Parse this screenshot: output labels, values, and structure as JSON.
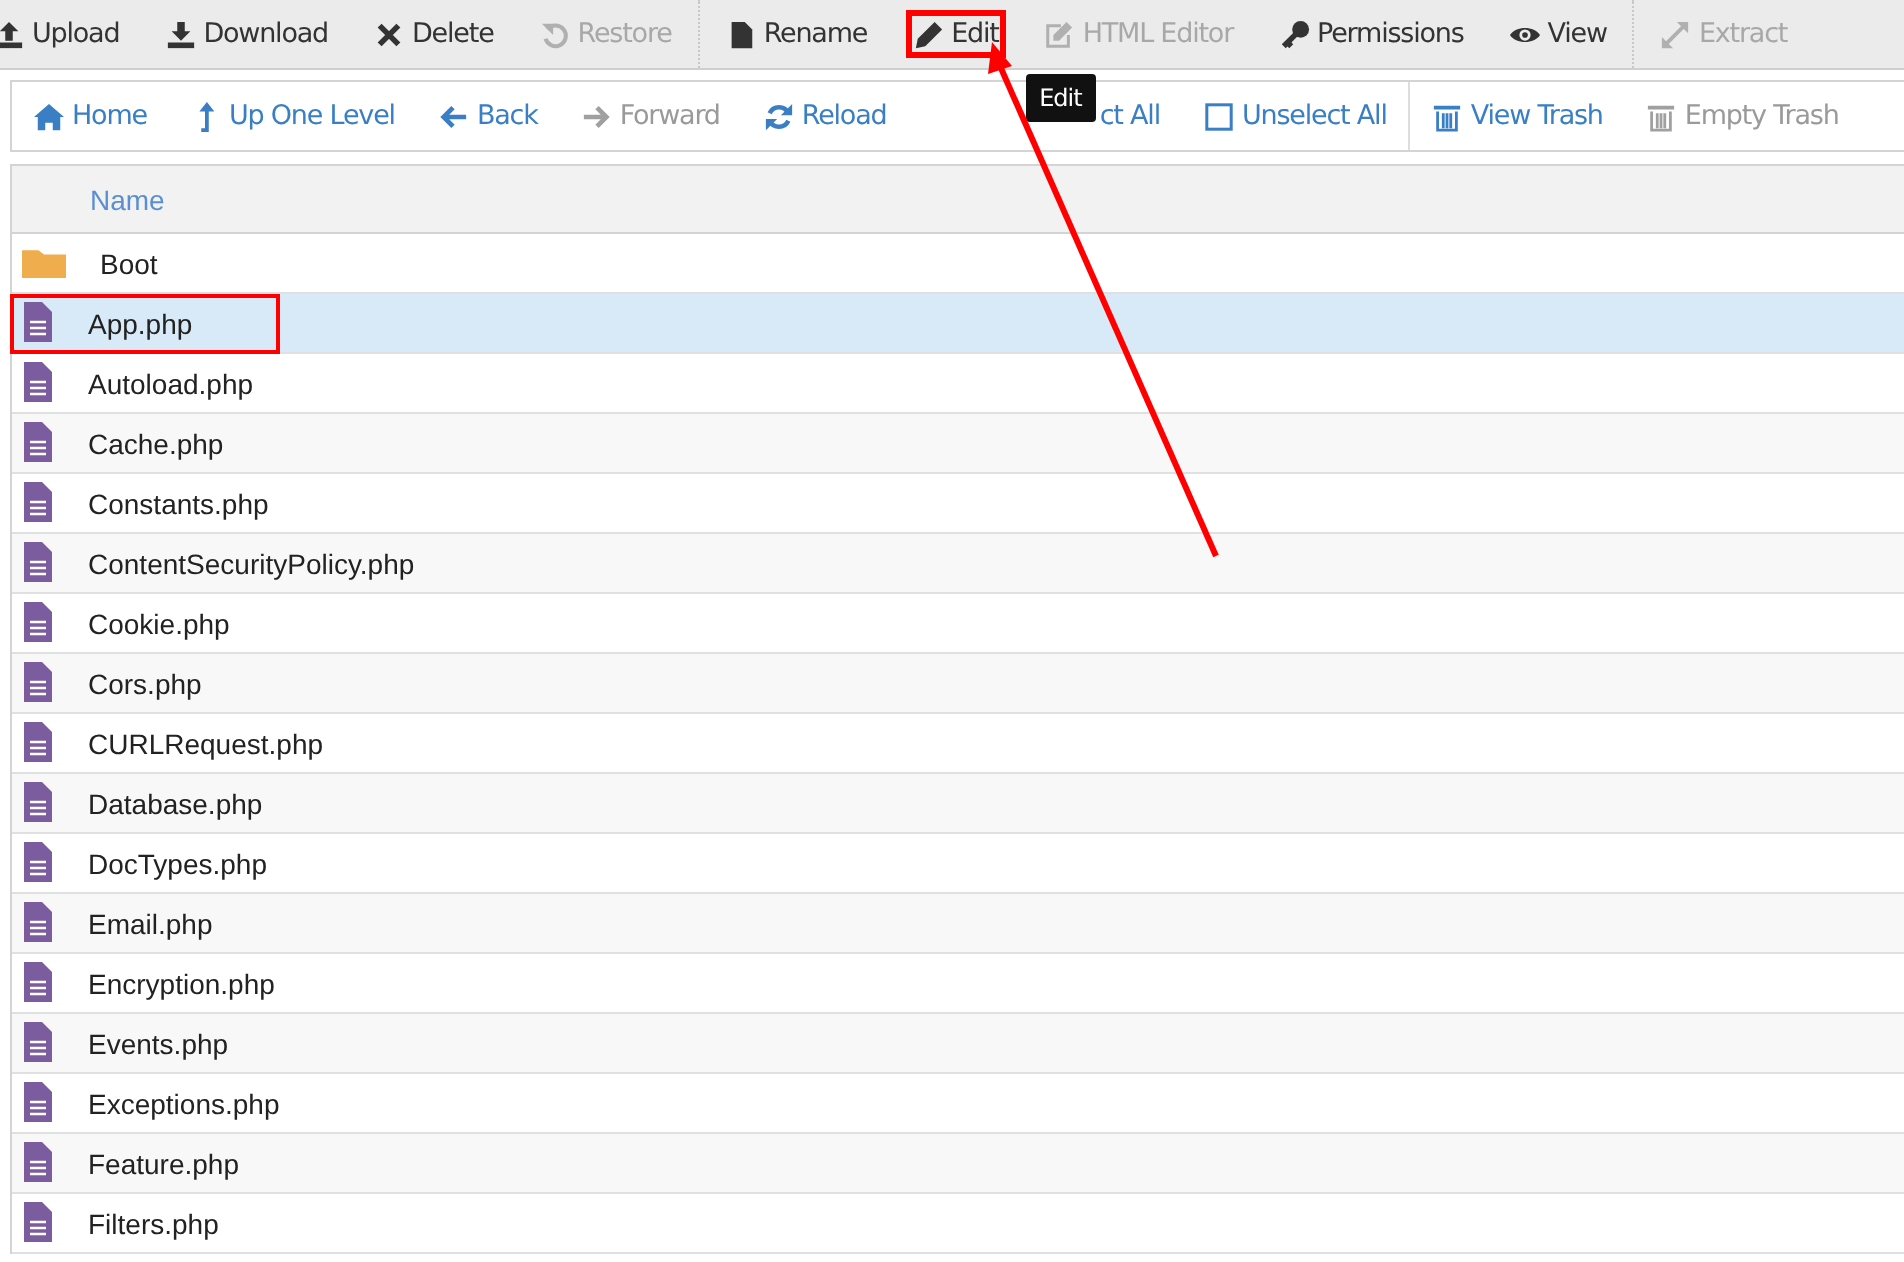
{
  "toolbar": {
    "groups": [
      [
        {
          "label": "Upload",
          "disabled": false,
          "highlighted": false
        },
        {
          "label": "Download",
          "disabled": false,
          "highlighted": false
        },
        {
          "label": "Delete",
          "disabled": false,
          "highlighted": false
        },
        {
          "label": "Restore",
          "disabled": true,
          "highlighted": false
        }
      ],
      [
        {
          "label": "Rename",
          "disabled": false,
          "highlighted": false
        },
        {
          "label": "Edit",
          "disabled": false,
          "highlighted": true,
          "tooltip": "Edit"
        },
        {
          "label": "HTML Editor",
          "disabled": true,
          "highlighted": false
        },
        {
          "label": "Permissions",
          "disabled": false,
          "highlighted": false
        },
        {
          "label": "View",
          "disabled": false,
          "highlighted": false
        }
      ],
      [
        {
          "label": "Extract",
          "disabled": true,
          "highlighted": false
        }
      ]
    ]
  },
  "navbar": {
    "groups": [
      [
        {
          "label": "Home",
          "disabled": false
        },
        {
          "label": "Up One Level",
          "disabled": false
        },
        {
          "label": "Back",
          "disabled": false
        },
        {
          "label": "Forward",
          "disabled": true
        },
        {
          "label": "Reload",
          "disabled": false
        },
        {
          "label": "ct All",
          "disabled": false
        },
        {
          "label": "Unselect All",
          "disabled": false
        }
      ],
      [
        {
          "label": "View Trash",
          "disabled": false
        },
        {
          "label": "Empty Trash",
          "disabled": true
        }
      ]
    ]
  },
  "table": {
    "columns": [
      "Name"
    ],
    "rows": [
      {
        "kind": "folder",
        "name": "Boot",
        "selected": false,
        "highlighted": false
      },
      {
        "kind": "file",
        "name": "App.php",
        "selected": true,
        "highlighted": true
      },
      {
        "kind": "file",
        "name": "Autoload.php",
        "selected": false,
        "highlighted": false
      },
      {
        "kind": "file",
        "name": "Cache.php",
        "selected": false,
        "highlighted": false
      },
      {
        "kind": "file",
        "name": "Constants.php",
        "selected": false,
        "highlighted": false
      },
      {
        "kind": "file",
        "name": "ContentSecurityPolicy.php",
        "selected": false,
        "highlighted": false
      },
      {
        "kind": "file",
        "name": "Cookie.php",
        "selected": false,
        "highlighted": false
      },
      {
        "kind": "file",
        "name": "Cors.php",
        "selected": false,
        "highlighted": false
      },
      {
        "kind": "file",
        "name": "CURLRequest.php",
        "selected": false,
        "highlighted": false
      },
      {
        "kind": "file",
        "name": "Database.php",
        "selected": false,
        "highlighted": false
      },
      {
        "kind": "file",
        "name": "DocTypes.php",
        "selected": false,
        "highlighted": false
      },
      {
        "kind": "file",
        "name": "Email.php",
        "selected": false,
        "highlighted": false
      },
      {
        "kind": "file",
        "name": "Encryption.php",
        "selected": false,
        "highlighted": false
      },
      {
        "kind": "file",
        "name": "Events.php",
        "selected": false,
        "highlighted": false
      },
      {
        "kind": "file",
        "name": "Exceptions.php",
        "selected": false,
        "highlighted": false
      },
      {
        "kind": "file",
        "name": "Feature.php",
        "selected": false,
        "highlighted": false
      },
      {
        "kind": "file",
        "name": "Filters.php",
        "selected": false,
        "highlighted": false
      }
    ]
  }
}
